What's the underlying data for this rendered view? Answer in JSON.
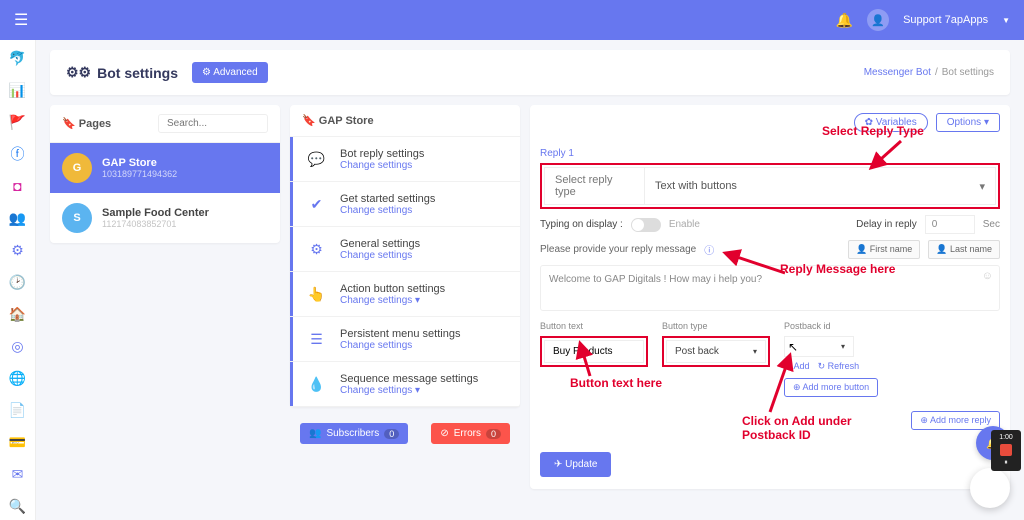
{
  "topbar": {
    "user": "Support 7apApps"
  },
  "header": {
    "title": "Bot settings",
    "advanced": "Advanced"
  },
  "breadcrumb": {
    "a": "Messenger Bot",
    "b": "Bot settings"
  },
  "pages": {
    "label": "Pages",
    "search_ph": "Search...",
    "items": [
      {
        "letter": "G",
        "name": "GAP Store",
        "id": "103189771494362"
      },
      {
        "letter": "S",
        "name": "Sample Food Center",
        "id": "112174083852701"
      }
    ]
  },
  "settings": {
    "title": "GAP Store",
    "items": [
      {
        "title": "Bot reply settings",
        "link": "Change settings"
      },
      {
        "title": "Get started settings",
        "link": "Change settings"
      },
      {
        "title": "General settings",
        "link": "Change settings"
      },
      {
        "title": "Action button settings",
        "link": "Change settings"
      },
      {
        "title": "Persistent menu settings",
        "link": "Change settings"
      },
      {
        "title": "Sequence message settings",
        "link": "Change settings"
      }
    ]
  },
  "footer": {
    "subs": "Subscribers",
    "subs_n": "0",
    "err": "Errors",
    "err_n": "0"
  },
  "col3": {
    "variables": "Variables",
    "options": "Options"
  },
  "reply": {
    "label": "Reply 1",
    "select_label": "Select reply type",
    "select_value": "Text with buttons",
    "typing": "Typing on display :",
    "enable": "Enable",
    "delay": "Delay in reply",
    "delay_v": "0",
    "sec": "Sec",
    "provide": "Please provide your reply message",
    "first": "First name",
    "last": "Last name",
    "msg": "Welcome to GAP Digitals ! How may i help you?",
    "btn_text_l": "Button text",
    "btn_type_l": "Button type",
    "postback_l": "Postback id",
    "btn_text_v": "Buy Products",
    "btn_type_v": "Post back",
    "add": "Add",
    "refresh": "Refresh",
    "add_more_btn": "Add more button",
    "add_more_reply": "Add more reply",
    "update": "Update"
  },
  "ann": {
    "a1": "Select Reply Type",
    "a2": "Reply Message here",
    "a3": "Button text here",
    "a4": "Click on Add under",
    "a5": "Postback ID"
  },
  "rec": {
    "time": "1:00"
  }
}
